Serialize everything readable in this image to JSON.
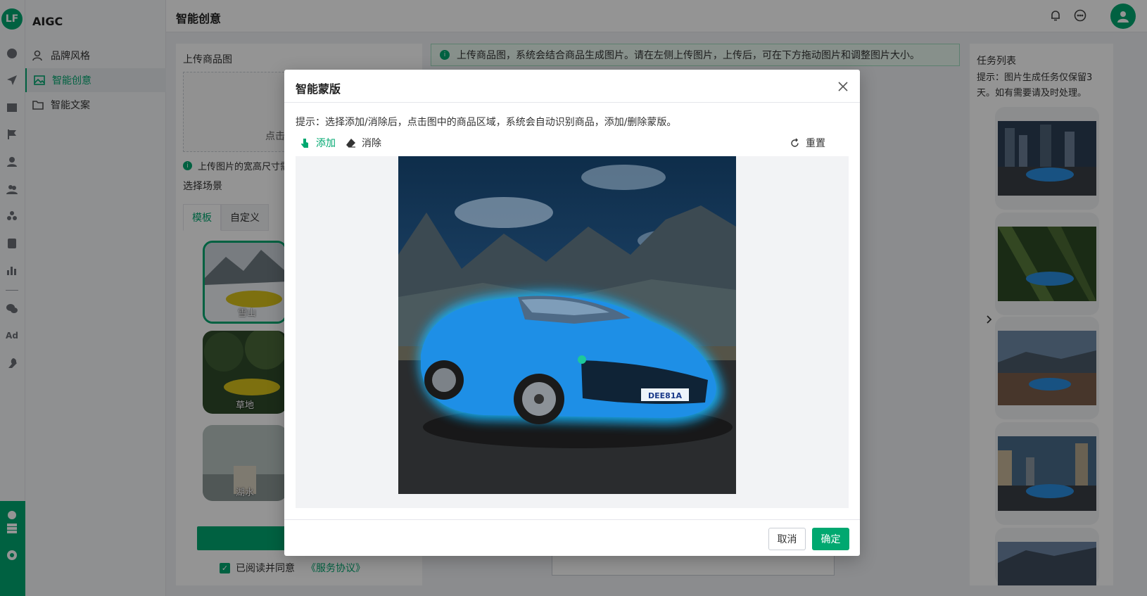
{
  "app": {
    "brand": "AIGC",
    "logo_text": "LF",
    "page_title": "智能创意"
  },
  "rail": {
    "ad_label": "Ad"
  },
  "menu": {
    "items": [
      {
        "label": "品牌风格",
        "icon": "user-style-icon"
      },
      {
        "label": "智能创意",
        "icon": "image-icon",
        "active": true
      },
      {
        "label": "智能文案",
        "icon": "folder-icon"
      }
    ]
  },
  "left_panel": {
    "upload_label": "上传商品图",
    "upload_hint": "点击",
    "size_tip": "上传图片的宽高尺寸需",
    "scene_label": "选择场景",
    "tabs": [
      "模板",
      "自定义"
    ],
    "scenes": [
      "雪山",
      "草地",
      "湖水"
    ],
    "agree_text": "已阅读并同意",
    "agree_link": "《服务协议》"
  },
  "banner": {
    "text": "上传商品图，系统会结合商品生成图片。请在左侧上传图片，上传后，可在下方拖动图片和调整图片大小。"
  },
  "right_panel": {
    "title": "任务列表",
    "tip": "提示：图片生成任务仅保留3天。如有需要请及时处理。"
  },
  "modal": {
    "title": "智能蒙版",
    "tip": "提示：选择添加/消除后，点击图中的商品区域，系统会自动识别商品，添加/删除蒙版。",
    "add_label": "添加",
    "erase_label": "消除",
    "reset_label": "重置",
    "plate_text": "DEE81A",
    "cancel_label": "取消",
    "ok_label": "确定"
  },
  "colors": {
    "accent": "#00a870",
    "mask_glow": "#19b8ff"
  }
}
